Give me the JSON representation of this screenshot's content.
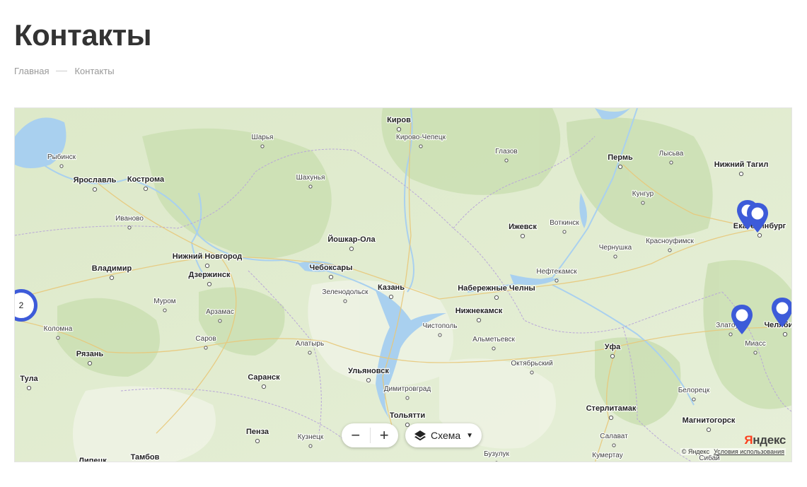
{
  "page": {
    "title": "Контакты"
  },
  "breadcrumb": {
    "home": "Главная",
    "current": "Контакты"
  },
  "map": {
    "cities": [
      {
        "name": "Киров",
        "major": true
      },
      {
        "name": "Кирово-Чепецк",
        "major": false
      },
      {
        "name": "Шарья",
        "major": false
      },
      {
        "name": "Глазов",
        "major": false
      },
      {
        "name": "Пермь",
        "major": true
      },
      {
        "name": "Лысьва",
        "major": false
      },
      {
        "name": "Нижний Тагил",
        "major": true
      },
      {
        "name": "Рыбинск",
        "major": false
      },
      {
        "name": "Ярославль",
        "major": true
      },
      {
        "name": "Кострома",
        "major": true
      },
      {
        "name": "Шахунья",
        "major": false
      },
      {
        "name": "Кунгур",
        "major": false
      },
      {
        "name": "Иваново",
        "major": false
      },
      {
        "name": "Ижевск",
        "major": true
      },
      {
        "name": "Воткинск",
        "major": false
      },
      {
        "name": "Екатеринбург",
        "major": true
      },
      {
        "name": "Йошкар-Ола",
        "major": true
      },
      {
        "name": "Чернушка",
        "major": false
      },
      {
        "name": "Красноуфимск",
        "major": false
      },
      {
        "name": "Нижний Новгород",
        "major": true
      },
      {
        "name": "Владимир",
        "major": true
      },
      {
        "name": "Чебоксары",
        "major": true
      },
      {
        "name": "Дзержинск",
        "major": true
      },
      {
        "name": "Нефтекамск",
        "major": false
      },
      {
        "name": "Набережные Челны",
        "major": true
      },
      {
        "name": "Зеленодольск",
        "major": false
      },
      {
        "name": "Казань",
        "major": true
      },
      {
        "name": "Муром",
        "major": false
      },
      {
        "name": "Нижнекамск",
        "major": true
      },
      {
        "name": "Арзамас",
        "major": false
      },
      {
        "name": "Коломна",
        "major": false
      },
      {
        "name": "Чистополь",
        "major": false
      },
      {
        "name": "Златоуст",
        "major": false
      },
      {
        "name": "Челябинск",
        "major": true
      },
      {
        "name": "Альметьевск",
        "major": false
      },
      {
        "name": "Саров",
        "major": false
      },
      {
        "name": "Алатырь",
        "major": false
      },
      {
        "name": "Уфа",
        "major": true
      },
      {
        "name": "Миасс",
        "major": false
      },
      {
        "name": "Рязань",
        "major": true
      },
      {
        "name": "Октябрьский",
        "major": false
      },
      {
        "name": "Тула",
        "major": true
      },
      {
        "name": "Ульяновск",
        "major": true
      },
      {
        "name": "Саранск",
        "major": true
      },
      {
        "name": "Димитровград",
        "major": false
      },
      {
        "name": "Белорецк",
        "major": false
      },
      {
        "name": "Стерлитамак",
        "major": true
      },
      {
        "name": "Тольятти",
        "major": true
      },
      {
        "name": "Магнитогорск",
        "major": true
      },
      {
        "name": "Пенза",
        "major": true
      },
      {
        "name": "Кузнецк",
        "major": false
      },
      {
        "name": "Салават",
        "major": false
      },
      {
        "name": "Бузулук",
        "major": false
      },
      {
        "name": "Кумертау",
        "major": false
      },
      {
        "name": "Тамбов",
        "major": true
      },
      {
        "name": "Липецк",
        "major": true
      },
      {
        "name": "Сибай",
        "major": false
      }
    ],
    "cluster_count": "2",
    "zoom_out_label": "−",
    "zoom_in_label": "+",
    "layer_label": "Схема",
    "logo_first": "Я",
    "logo_rest": "ндекс",
    "copyright": "© Яндекс",
    "terms": "Условия использования",
    "marker_color": "#3d5bd9"
  }
}
